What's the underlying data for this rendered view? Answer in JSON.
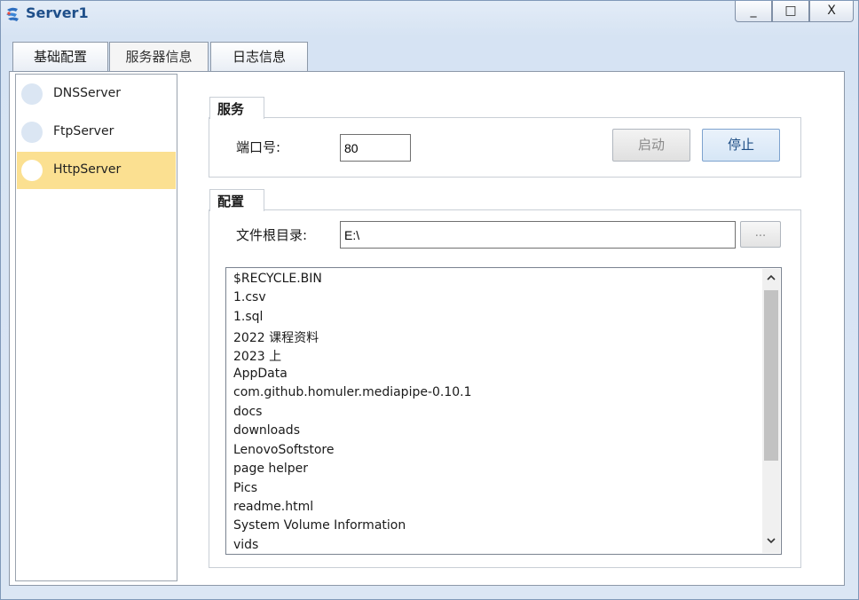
{
  "window": {
    "title": "Server1",
    "minimize_label": "_",
    "maximize_label": "□",
    "close_label": "X"
  },
  "tabs": [
    {
      "label": "基础配置"
    },
    {
      "label": "服务器信息"
    },
    {
      "label": "日志信息"
    }
  ],
  "active_tab": "服务器信息",
  "servers": [
    {
      "label": "DNSServer"
    },
    {
      "label": "FtpServer"
    },
    {
      "label": "HttpServer"
    }
  ],
  "selected_server": "HttpServer",
  "service_group": {
    "title": "服务",
    "port_label": "端口号:",
    "port_value": "80",
    "start_label": "启动",
    "stop_label": "停止"
  },
  "config_group": {
    "title": "配置",
    "root_dir_label": "文件根目录:",
    "root_dir_value": "E:\\",
    "browse_label": "..."
  },
  "files": [
    "$RECYCLE.BIN",
    "1.csv",
    "1.sql",
    "2022 课程资料",
    "2023 上",
    "AppData",
    "com.github.homuler.mediapipe-0.10.1",
    "docs",
    "downloads",
    "LenovoSoftstore",
    "page helper",
    "Pics",
    "readme.html",
    "System Volume Information",
    "vids"
  ],
  "colors": {
    "title_text": "#1e4f8a",
    "selected_item_bg": "#fbe091",
    "stop_button_text": "#1f4f86"
  }
}
